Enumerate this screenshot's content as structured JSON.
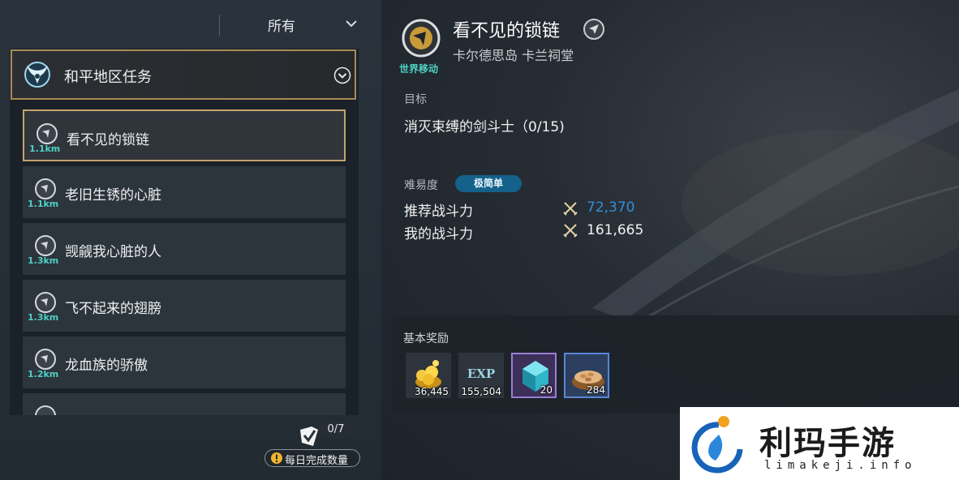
{
  "filter": {
    "label": "所有"
  },
  "group": {
    "title": "和平地区任务"
  },
  "quests": [
    {
      "name": "看不见的锁链",
      "distance": "1.1km",
      "selected": true
    },
    {
      "name": "老旧生锈的心脏",
      "distance": "1.1km"
    },
    {
      "name": "觊觎我心脏的人",
      "distance": "1.3km"
    },
    {
      "name": "飞不起来的翅膀",
      "distance": "1.3km"
    },
    {
      "name": "龙血族的骄傲",
      "distance": "1.2km"
    }
  ],
  "daily": {
    "count": "0/7",
    "label": "每日完成数量"
  },
  "detail": {
    "tag": "世界移动",
    "title": "看不见的锁链",
    "location": "卡尔德思岛 卡兰祠堂",
    "goal_heading": "目标",
    "goal_text": "消灭束缚的剑斗士（0/15)",
    "difficulty_heading": "难易度",
    "difficulty_value": "极简单",
    "recommended_cp_label": "推荐战斗力",
    "recommended_cp_value": "72,370",
    "my_cp_label": "我的战斗力",
    "my_cp_value": "161,665"
  },
  "rewards": {
    "heading": "基本奖励",
    "items": [
      {
        "icon": "gold-coins-icon",
        "qty": "36,445"
      },
      {
        "icon": "exp-icon",
        "label": "EXP",
        "qty": "155,504"
      },
      {
        "icon": "crystal-cube-icon",
        "qty": "20"
      },
      {
        "icon": "nuts-basket-icon",
        "qty": "284"
      }
    ]
  },
  "watermark": {
    "text": "利玛手游",
    "url": "limakeji.info"
  },
  "colors": {
    "accent_gold": "#c5a46b",
    "distance_teal": "#4fd1c5",
    "recommended_cp_blue": "#2f8fd6",
    "difficulty_badge": "#14618b"
  }
}
